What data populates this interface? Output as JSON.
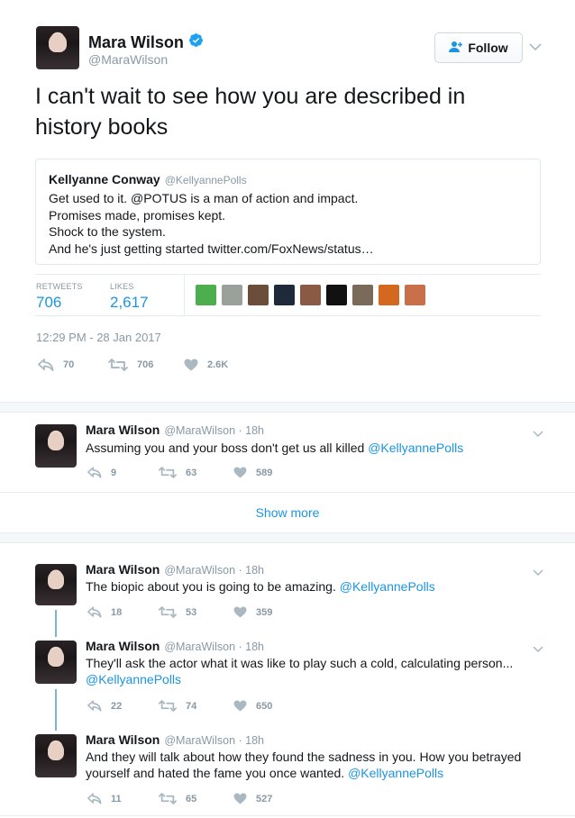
{
  "main_tweet": {
    "name": "Mara Wilson",
    "handle": "@MaraWilson",
    "follow_label": "Follow",
    "text": "I can't wait to see how you are described in history books",
    "quote": {
      "name": "Kellyanne Conway",
      "handle": "@KellyannePolls",
      "lines": [
        "Get used to it. @POTUS is a man of action and impact.",
        "Promises made, promises kept.",
        "Shock to the system.",
        "And he's just getting started twitter.com/FoxNews/status…"
      ]
    },
    "stats": {
      "retweets_label": "RETWEETS",
      "retweets": "706",
      "likes_label": "LIKES",
      "likes": "2,617"
    },
    "timestamp": "12:29 PM - 28 Jan 2017",
    "actions": {
      "replies": "70",
      "retweets": "706",
      "likes": "2.6K"
    },
    "liker_colors": [
      "#4cae4c",
      "#9aa09a",
      "#6a4e3a",
      "#1e2a3a",
      "#8a5a44",
      "#111111",
      "#7a6a5a",
      "#d2691e",
      "#c9704a"
    ]
  },
  "replies": [
    {
      "name": "Mara Wilson",
      "handle": "@MaraWilson · 18h",
      "text": "Assuming you and your boss don't get us all killed ",
      "mention": "@KellyannePolls",
      "replies": "9",
      "retweets": "63",
      "likes": "589"
    }
  ],
  "show_more": "Show more",
  "thread": [
    {
      "name": "Mara Wilson",
      "handle": "@MaraWilson · 18h",
      "text": "The biopic about you is going to be amazing. ",
      "mention": "@KellyannePolls",
      "replies": "18",
      "retweets": "53",
      "likes": "359"
    },
    {
      "name": "Mara Wilson",
      "handle": "@MaraWilson · 18h",
      "text": "They'll ask the actor what it was like to play such a cold, calculating person...",
      "mention": "@KellyannePolls",
      "replies": "22",
      "retweets": "74",
      "likes": "650"
    },
    {
      "name": "Mara Wilson",
      "handle": "@MaraWilson · 18h",
      "text": "And they will talk about how they found the sadness in you. How you betrayed yourself and hated the fame you once wanted. ",
      "mention": "@KellyannePolls",
      "replies": "11",
      "retweets": "65",
      "likes": "527"
    }
  ],
  "colors": {
    "accent": "#1b95e0",
    "muted": "#8899a6",
    "verified": "#1da1f2"
  }
}
